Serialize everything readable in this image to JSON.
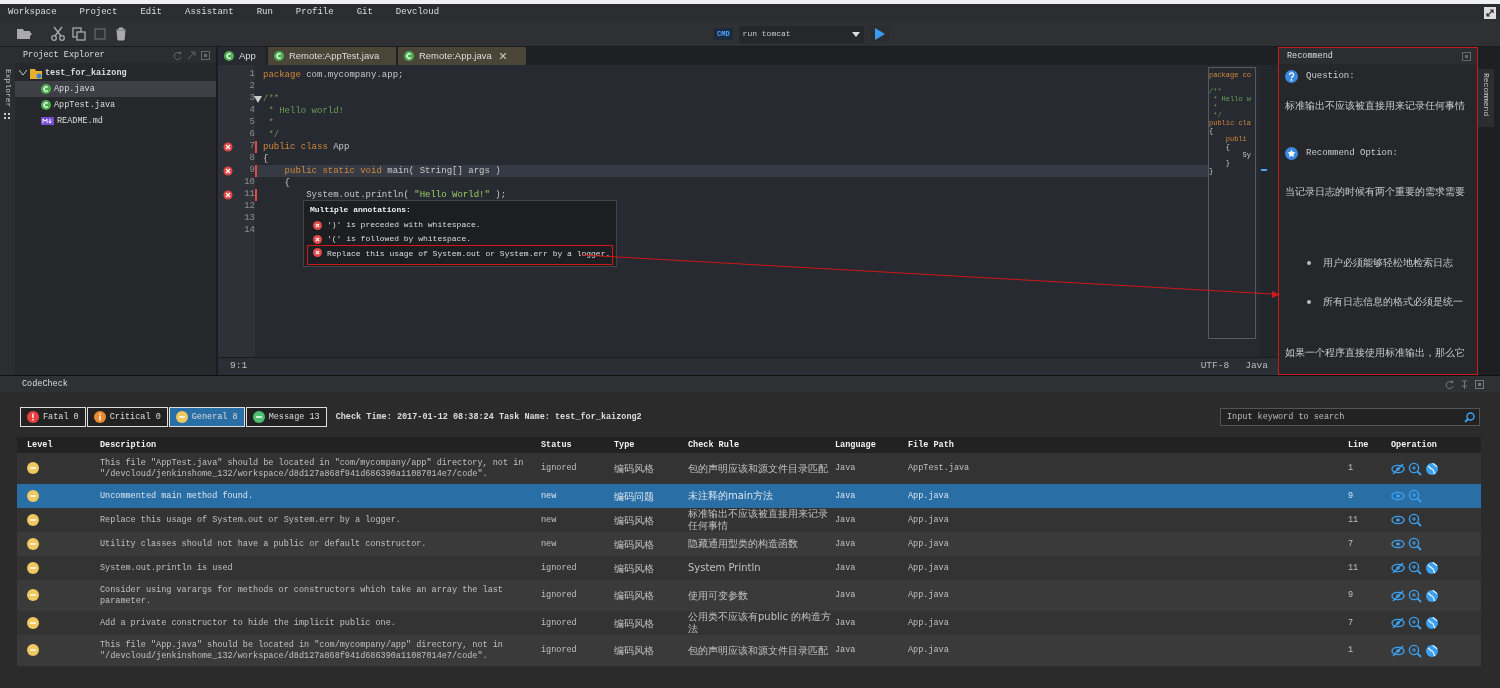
{
  "menu": [
    "Workspace",
    "Project",
    "Edit",
    "Assistant",
    "Run",
    "Profile",
    "Git",
    "Devcloud"
  ],
  "toolbar": {
    "run_badge": "CMD",
    "run_config": "run tomcat"
  },
  "side_tabs": {
    "left": "Explorer",
    "right": "Recommend"
  },
  "explorer": {
    "title": "Project Explorer",
    "tree": [
      {
        "label": "test_for_kaizong",
        "kind": "project",
        "expanded": true,
        "selected": false,
        "children": [
          {
            "label": "App.java",
            "kind": "java",
            "selected": true
          },
          {
            "label": "AppTest.java",
            "kind": "java",
            "selected": false
          },
          {
            "label": "README.md",
            "kind": "markdown",
            "selected": false
          }
        ]
      }
    ]
  },
  "editor_tabs": [
    {
      "label": "App",
      "selected": true,
      "closable": false
    },
    {
      "label": "Remote:AppTest.java",
      "selected": false,
      "closable": false
    },
    {
      "label": "Remote:App.java",
      "selected": false,
      "closable": true
    }
  ],
  "code": {
    "lines": [
      {
        "number": "1",
        "error": false,
        "fold": false,
        "current": false,
        "tokens": [
          {
            "kind": "keyword",
            "text": "package"
          },
          {
            "kind": "plain",
            "text": " com.mycompany.app;"
          }
        ]
      },
      {
        "number": "2",
        "error": false,
        "fold": false,
        "current": false
      },
      {
        "number": "3",
        "error": false,
        "fold": true,
        "current": false,
        "tokens": [
          {
            "kind": "comment",
            "text": "/**"
          }
        ]
      },
      {
        "number": "4",
        "error": false,
        "fold": false,
        "current": false,
        "tokens": [
          {
            "kind": "comment",
            "text": " * Hello world!"
          }
        ]
      },
      {
        "number": "5",
        "error": false,
        "fold": false,
        "current": false,
        "tokens": [
          {
            "kind": "comment",
            "text": " *"
          }
        ]
      },
      {
        "number": "6",
        "error": false,
        "fold": false,
        "current": false,
        "tokens": [
          {
            "kind": "comment",
            "text": " */"
          }
        ]
      },
      {
        "number": "7",
        "error": true,
        "fold": false,
        "current": false,
        "tokens": [
          {
            "kind": "keyword",
            "text": "public class"
          },
          {
            "kind": "plain",
            "text": " App"
          }
        ]
      },
      {
        "number": "8",
        "error": false,
        "fold": false,
        "current": false,
        "tokens": [
          {
            "kind": "plain",
            "text": "{"
          }
        ]
      },
      {
        "number": "9",
        "error": true,
        "fold": false,
        "current": true,
        "tokens": [
          {
            "kind": "keyword",
            "text": "    public static void"
          },
          {
            "kind": "plain",
            "text": " main( String[] args )"
          }
        ]
      },
      {
        "number": "10",
        "error": false,
        "fold": false,
        "current": false,
        "tokens": [
          {
            "kind": "plain",
            "text": "    {"
          }
        ]
      },
      {
        "number": "11",
        "error": true,
        "fold": false,
        "current": false,
        "tokens": [
          {
            "kind": "plain",
            "text": "        System.out.println( "
          },
          {
            "kind": "string",
            "text": "\"Hello World!\""
          },
          {
            "kind": "plain",
            "text": " );"
          }
        ]
      },
      {
        "number": "12",
        "error": false,
        "fold": false,
        "current": false
      },
      {
        "number": "13",
        "error": false,
        "fold": false,
        "current": false
      },
      {
        "number": "14",
        "error": false,
        "fold": false,
        "current": false
      }
    ]
  },
  "tooltip": {
    "title": "Multiple annotations:",
    "items": [
      {
        "text": "')' is preceded with whitespace.",
        "highlighted": false
      },
      {
        "text": "'(' is followed by whitespace.",
        "highlighted": false
      },
      {
        "text": "Replace this usage of System.out or System.err by a logger.",
        "highlighted": true
      }
    ]
  },
  "minimap": [
    {
      "kind": "keyword",
      "text": "package co"
    },
    {
      "kind": "plain"
    },
    {
      "kind": "comment",
      "text": "/**"
    },
    {
      "kind": "comment",
      "text": " * Hello w"
    },
    {
      "kind": "comment",
      "text": " *"
    },
    {
      "kind": "comment",
      "text": " */"
    },
    {
      "kind": "keyword",
      "text": "public cla"
    },
    {
      "kind": "plain",
      "text": "{"
    },
    {
      "kind": "keyword",
      "text": "    publi"
    },
    {
      "kind": "plain",
      "text": "    {"
    },
    {
      "kind": "plain",
      "text": "        Sy"
    },
    {
      "kind": "plain",
      "text": "    }"
    },
    {
      "kind": "plain",
      "text": "}"
    }
  ],
  "status": {
    "position": "9:1",
    "encoding": "UTF-8",
    "language": "Java"
  },
  "recommend": {
    "title": "Recommend",
    "question_label": "Question:",
    "question": "标准输出不应该被直接用来记录任何事情",
    "option_label": "Recommend Option:",
    "option_intro": "当记录日志的时候有两个重要的需求需要",
    "bullets": [
      "用户必须能够轻松地检索日志",
      "所有日志信息的格式必须是统一"
    ],
    "trailing": "如果一个程序直接使用标准输出，那么它"
  },
  "codecheck": {
    "title": "CodeCheck",
    "filters": [
      {
        "label": "Fatal 0",
        "kind": "fatal",
        "selected": false
      },
      {
        "label": "Critical 0",
        "kind": "critical",
        "selected": false
      },
      {
        "label": "General 8",
        "kind": "general",
        "selected": true
      },
      {
        "label": "Message 13",
        "kind": "message",
        "selected": false
      }
    ],
    "check_info": "Check Time: 2017-01-12 08:38:24 Task Name: test_for_kaizong2",
    "search": {
      "placeholder": "Input keyword to search"
    },
    "columns": [
      "Level",
      "Description",
      "Status",
      "Type",
      "Check Rule",
      "Language",
      "File Path",
      "Line",
      "Operation"
    ],
    "rows": [
      {
        "kind": "general",
        "description": "This file \"AppTest.java\" should be located in \"com/mycompany/app\" directory, not in \"/devcloud/jenkinshome_132/workspace/d8d127a868f941d686390a11087014e7/code\".",
        "status": "ignored",
        "type": "编码风格",
        "check_rule": "包的声明应该和源文件目录匹配",
        "language": "Java",
        "file_path": "AppTest.java",
        "line": "1",
        "selected": false,
        "ignored": true
      },
      {
        "kind": "general",
        "description": "Uncommented main method found.",
        "status": "new",
        "type": "编码问题",
        "check_rule": "未注释的main方法",
        "language": "Java",
        "file_path": "App.java",
        "line": "9",
        "selected": true,
        "ignored": false
      },
      {
        "kind": "general",
        "description": "Replace this usage of System.out or System.err by a logger.",
        "status": "new",
        "type": "编码风格",
        "check_rule": "标准输出不应该被直接用来记录任何事情",
        "language": "Java",
        "file_path": "App.java",
        "line": "11",
        "selected": false,
        "ignored": false
      },
      {
        "kind": "general",
        "description": "Utility classes should not have a public or default constructor.",
        "status": "new",
        "type": "编码风格",
        "check_rule": "隐藏通用型类的构造函数",
        "language": "Java",
        "file_path": "App.java",
        "line": "7",
        "selected": false,
        "ignored": false
      },
      {
        "kind": "general",
        "description": "System.out.println is used",
        "status": "ignored",
        "type": "编码风格",
        "check_rule": "System Println",
        "language": "Java",
        "file_path": "App.java",
        "line": "11",
        "selected": false,
        "ignored": true
      },
      {
        "kind": "general",
        "description": "Consider using varargs for methods or constructors which take an array the last parameter.",
        "status": "ignored",
        "type": "编码风格",
        "check_rule": "使用可变参数",
        "language": "Java",
        "file_path": "App.java",
        "line": "9",
        "selected": false,
        "ignored": true
      },
      {
        "kind": "general",
        "description": "Add a private constructor to hide the implicit public one.",
        "status": "ignored",
        "type": "编码风格",
        "check_rule": "公用类不应该有public 的构造方法",
        "language": "Java",
        "file_path": "App.java",
        "line": "7",
        "selected": false,
        "ignored": true
      },
      {
        "kind": "general",
        "description": "This file \"App.java\" should be located in \"com/mycompany/app\" directory, not in \"/devcloud/jenkinshome_132/workspace/d8d127a868f941d686390a11087014e7/code\".",
        "status": "ignored",
        "type": "编码风格",
        "check_rule": "包的声明应该和源文件目录匹配",
        "language": "Java",
        "file_path": "App.java",
        "line": "1",
        "selected": false,
        "ignored": true
      }
    ]
  }
}
